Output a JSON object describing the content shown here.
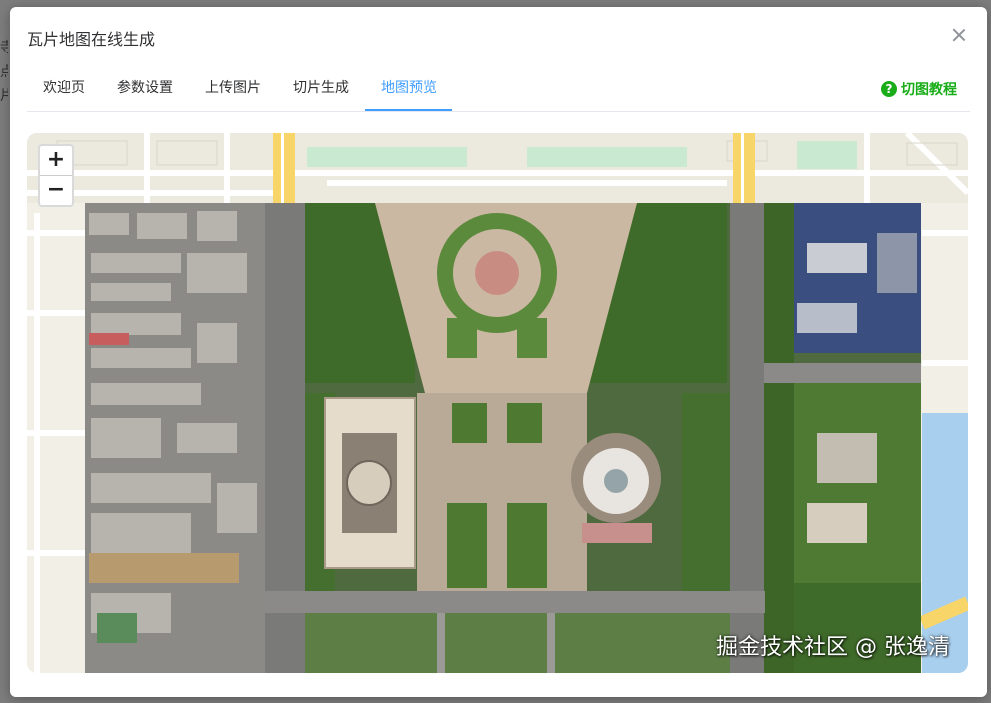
{
  "background": {
    "chars": [
      "寺",
      "点",
      "片",
      "(",
      "(",
      "(",
      "("
    ]
  },
  "dialog": {
    "title": "瓦片地图在线生成"
  },
  "tabs": [
    {
      "label": "欢迎页"
    },
    {
      "label": "参数设置"
    },
    {
      "label": "上传图片"
    },
    {
      "label": "切片生成"
    },
    {
      "label": "地图预览"
    }
  ],
  "active_tab": "地图预览",
  "help": {
    "label": "切图教程",
    "icon": "question-circle-icon",
    "color": "#1aad19"
  },
  "map": {
    "zoom_in": "+",
    "zoom_out": "−",
    "watermark": "掘金技术社区 @ 张逸清"
  },
  "colors": {
    "accent": "#409eff",
    "road_yellow": "#f8d568",
    "park_green": "#c9e9d0"
  }
}
